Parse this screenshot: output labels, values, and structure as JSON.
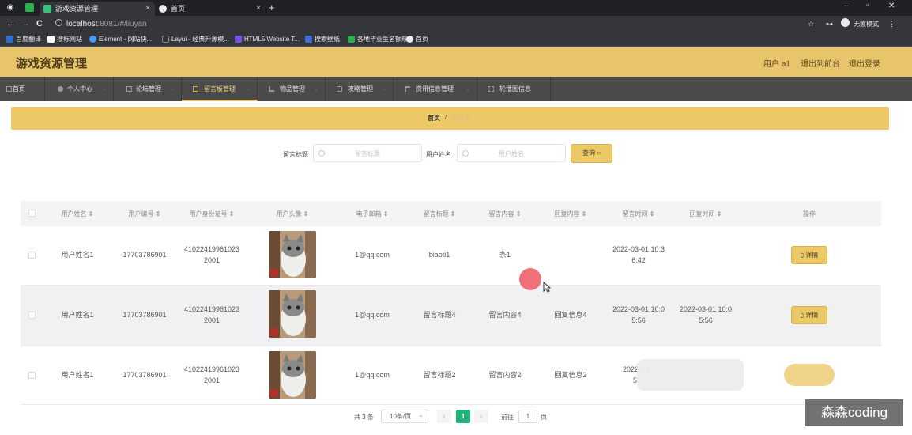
{
  "browser": {
    "tabs": [
      {
        "title": "游戏资源管理",
        "close": "×"
      },
      {
        "title": "首页",
        "close": "×"
      }
    ],
    "new_tab": "+",
    "window_controls": {
      "minimize": "–",
      "maximize": "▫",
      "close": "✕"
    },
    "nav": {
      "back": "←",
      "forward": "→",
      "reload": "C"
    },
    "url_host": "localhost",
    "url_path": ":8081/#/liuyan",
    "right_status": "无痕模式",
    "right_icons": {
      "star": "☆",
      "key": "⊶",
      "menu": "⋮"
    },
    "bookmarks": [
      {
        "label": "百度翻译",
        "color": "#2c6fd6"
      },
      {
        "label": "搜标网站",
        "color": "#ffffff"
      },
      {
        "label": "Element - 网站快...",
        "color": "#409eff"
      },
      {
        "label": "Layui - 经典开源模...",
        "color": "#333333"
      },
      {
        "label": "HTML5 Website T...",
        "color": "#7b4ff0"
      },
      {
        "label": "搜索壁纸",
        "color": "#3f6fd8"
      },
      {
        "label": "各地毕业生名额规",
        "color": "#2bb24c"
      },
      {
        "label": "首页",
        "color": "#e8eaed"
      }
    ]
  },
  "header": {
    "app_title": "游戏资源管理",
    "user": "用户 a1",
    "back_to_front": "退出到前台",
    "logout": "退出登录"
  },
  "nav": [
    {
      "label": "首页",
      "has_caret": false
    },
    {
      "label": "个人中心",
      "has_caret": true
    },
    {
      "label": "论坛管理",
      "has_caret": true
    },
    {
      "label": "留言板管理",
      "has_caret": true
    },
    {
      "label": "物品管理",
      "has_caret": true
    },
    {
      "label": "攻略管理",
      "has_caret": true
    },
    {
      "label": "资讯信息管理",
      "has_caret": true
    },
    {
      "label": "轮播图信息",
      "has_caret": false
    }
  ],
  "nav_active_index": 3,
  "breadcrumb": {
    "home": "首页",
    "separator": "/",
    "current": "留言板"
  },
  "search": {
    "title_label": "留言标题",
    "title_placeholder": "留言标题",
    "name_label": "用户姓名",
    "name_placeholder": "用户姓名",
    "query_button": "查询"
  },
  "table": {
    "columns": [
      "用户姓名",
      "用户编号",
      "用户身份证号",
      "用户头像",
      "电子邮箱",
      "留言标题",
      "留言内容",
      "回复内容",
      "留言时间",
      "回复时间",
      "操作"
    ],
    "sort_icon": "⇕",
    "detail_label": "详情",
    "rows": [
      {
        "name": "用户姓名1",
        "phone": "17703786901",
        "id_line1": "41022419961023",
        "id_line2": "2001",
        "email": "1@qq.com",
        "title": "biaoti1",
        "content": "条1",
        "reply": "",
        "time_line1": "2022-03-01 10:3",
        "time_line2": "6:42",
        "reply_time_line1": "",
        "reply_time_line2": ""
      },
      {
        "name": "用户姓名1",
        "phone": "17703786901",
        "id_line1": "41022419961023",
        "id_line2": "2001",
        "email": "1@qq.com",
        "title": "留言标题4",
        "content": "留言内容4",
        "reply": "回复信息4",
        "time_line1": "2022-03-01 10:0",
        "time_line2": "5:56",
        "reply_time_line1": "2022-03-01 10:0",
        "reply_time_line2": "5:56"
      },
      {
        "name": "用户姓名1",
        "phone": "17703786901",
        "id_line1": "41022419961023",
        "id_line2": "2001",
        "email": "1@qq.com",
        "title": "留言标题2",
        "content": "留言内容2",
        "reply": "回复信息2",
        "time_line1": "2022-03",
        "time_line2": "5:",
        "reply_time_line1": "",
        "reply_time_line2": ""
      }
    ]
  },
  "pagination": {
    "total": "共 3 条",
    "page_size": "10条/页",
    "page_size_caret": "⌄",
    "prev": "‹",
    "current_page": "1",
    "next": "›",
    "goto_label": "前往",
    "goto_value": "1",
    "page_suffix": "页"
  },
  "watermark": "森森coding"
}
